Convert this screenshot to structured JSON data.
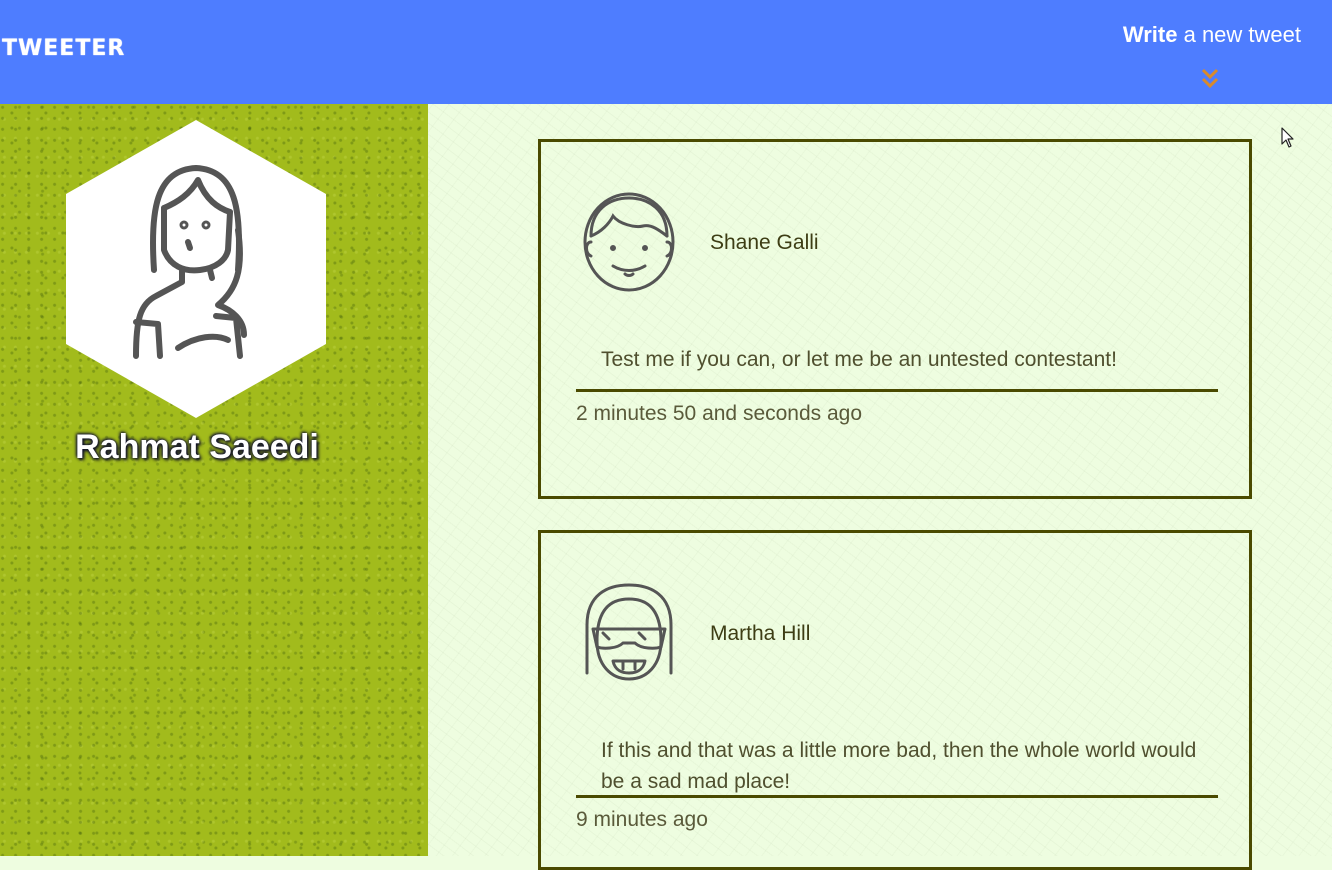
{
  "header": {
    "brand": "TWEETER",
    "compose_strong": "Write",
    "compose_rest": " a new tweet",
    "compose_icon": "double-chevron-down-icon",
    "background_color": "#4e7dff",
    "arrow_color": "#d98a2b"
  },
  "profile": {
    "name": "Rahmat Saeedi",
    "avatar_icon": "woman-avatar-icon",
    "sidebar_color": "#a2bb1c"
  },
  "tweets": [
    {
      "author": "Shane Galli",
      "avatar_icon": "smiling-man-avatar-icon",
      "text": "Test me if you can, or let me be an untested contestant!",
      "time": "2 minutes 50 and seconds ago"
    },
    {
      "author": "Martha Hill",
      "avatar_icon": "sunglasses-girl-avatar-icon",
      "text": "If this and that was a little more bad, then the whole world would be a sad mad place!",
      "time": "9 minutes ago"
    }
  ],
  "colors": {
    "feed_background": "#eefde0",
    "tweet_border": "#4a4a00"
  }
}
